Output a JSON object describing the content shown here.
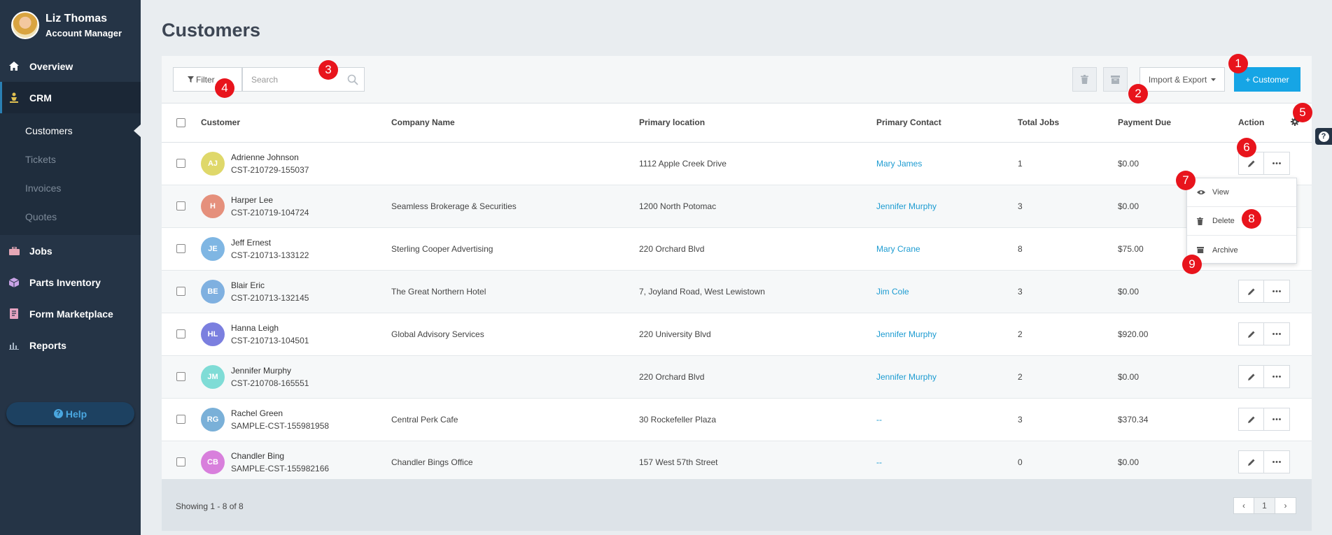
{
  "user": {
    "name": "Liz Thomas",
    "role": "Account Manager"
  },
  "sidebar": {
    "items": [
      {
        "label": "Overview",
        "icon": "home-icon"
      },
      {
        "label": "CRM",
        "icon": "crm-icon"
      },
      {
        "label": "Jobs",
        "icon": "briefcase-icon"
      },
      {
        "label": "Parts Inventory",
        "icon": "box-icon"
      },
      {
        "label": "Form Marketplace",
        "icon": "form-icon"
      },
      {
        "label": "Reports",
        "icon": "bar-chart-icon"
      }
    ],
    "crm_sub": [
      "Customers",
      "Tickets",
      "Invoices",
      "Quotes"
    ],
    "help_label": "Help"
  },
  "page": {
    "title": "Customers"
  },
  "toolbar": {
    "filter_label": "Filter",
    "search_placeholder": "Search",
    "import_export_label": "Import & Export",
    "add_label": "+ Customer"
  },
  "table": {
    "headers": [
      "Customer",
      "Company Name",
      "Primary location",
      "Primary Contact",
      "Total Jobs",
      "Payment Due",
      "Action"
    ],
    "rows": [
      {
        "initials": "AJ",
        "color": "#dfd86a",
        "name": "Adrienne Johnson",
        "id": "CST-210729-155037",
        "company": "",
        "location": "1112 Apple Creek Drive",
        "contact": "Mary James",
        "jobs": "1",
        "due": "$0.00"
      },
      {
        "initials": "H",
        "color": "#e5907c",
        "name": "Harper Lee",
        "id": "CST-210719-104724",
        "company": "Seamless Brokerage & Securities",
        "location": "1200 North Potomac",
        "contact": "Jennifer Murphy",
        "jobs": "3",
        "due": "$0.00"
      },
      {
        "initials": "JE",
        "color": "#7fb6e3",
        "name": "Jeff Ernest",
        "id": "CST-210713-133122",
        "company": "Sterling Cooper Advertising",
        "location": "220 Orchard Blvd",
        "contact": "Mary Crane",
        "jobs": "8",
        "due": "$75.00"
      },
      {
        "initials": "BE",
        "color": "#7fb0e0",
        "name": "Blair Eric",
        "id": "CST-210713-132145",
        "company": "The Great Northern Hotel",
        "location": "7, Joyland Road, West Lewistown",
        "contact": "Jim Cole",
        "jobs": "3",
        "due": "$0.00"
      },
      {
        "initials": "HL",
        "color": "#7b7fdf",
        "name": "Hanna Leigh",
        "id": "CST-210713-104501",
        "company": "Global Advisory Services",
        "location": "220 University Blvd",
        "contact": "Jennifer Murphy",
        "jobs": "2",
        "due": "$920.00"
      },
      {
        "initials": "JM",
        "color": "#7fdcd6",
        "name": "Jennifer Murphy",
        "id": "CST-210708-165551",
        "company": "",
        "location": "220 Orchard Blvd",
        "contact": "Jennifer Murphy",
        "jobs": "2",
        "due": "$0.00"
      },
      {
        "initials": "RG",
        "color": "#7ab0d8",
        "name": "Rachel Green",
        "id": "SAMPLE-CST-155981958",
        "company": "Central Perk Cafe",
        "location": "30 Rockefeller Plaza",
        "contact": "--",
        "jobs": "3",
        "due": "$370.34"
      },
      {
        "initials": "CB",
        "color": "#d87fdc",
        "name": "Chandler Bing",
        "id": "SAMPLE-CST-155982166",
        "company": "Chandler Bings Office",
        "location": "157 West 57th Street",
        "contact": "--",
        "jobs": "0",
        "due": "$0.00"
      }
    ]
  },
  "dropdown": [
    "View",
    "Delete",
    "Archive"
  ],
  "footer": {
    "showing": "Showing 1 - 8 of 8",
    "page": "1",
    "prev": "‹",
    "next": "›"
  },
  "markers": [
    "1",
    "2",
    "3",
    "4",
    "5",
    "6",
    "7",
    "8",
    "9"
  ],
  "colors": {
    "sidebar": "#253446",
    "accent": "#16a5e5",
    "link": "#1c9bd1",
    "marker": "#e8141c"
  }
}
